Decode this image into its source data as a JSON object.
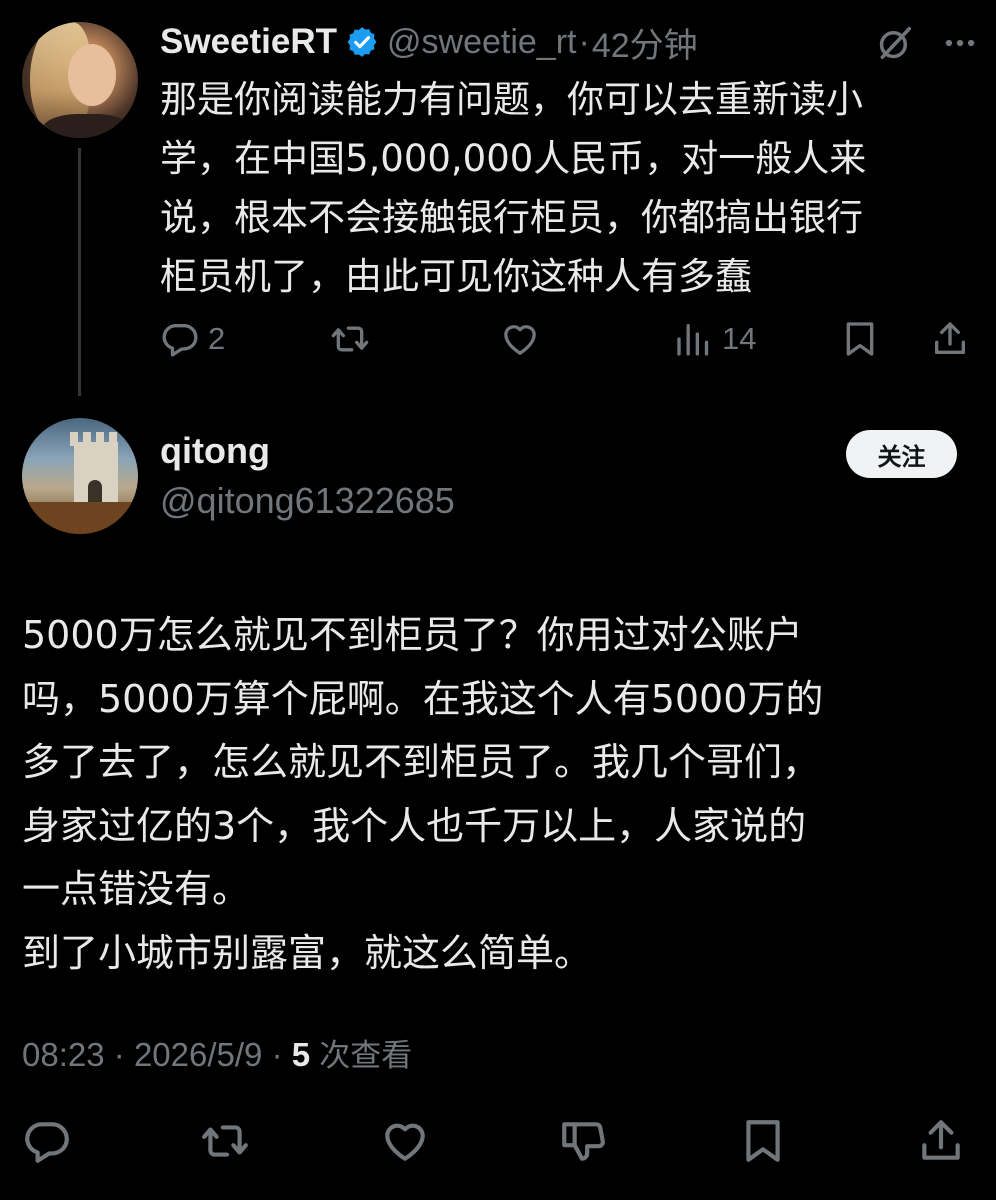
{
  "parent_tweet": {
    "display_name": "SweetieRT",
    "handle": "@sweetie_rt",
    "separator": "·",
    "time": "42分钟",
    "text": "那是你阅读能力有问题，你可以去重新读小\n学，在中国5,000,000人民币，对一般人来\n说，根本不会接触银行柜员，你都搞出银行\n柜员机了，由此可见你这种人有多蠢",
    "reply_count": "2",
    "view_count": "14",
    "icons": {
      "verified": "verified-badge-icon",
      "grok": "grok-icon",
      "more": "more-icon",
      "reply": "reply-icon",
      "retweet": "retweet-icon",
      "like": "like-icon",
      "views": "views-icon",
      "bookmark": "bookmark-icon",
      "share": "share-icon"
    }
  },
  "main_tweet": {
    "display_name": "qitong",
    "handle": "@qitong61322685",
    "follow_label": "关注",
    "text": "5000万怎么就见不到柜员了？你用过对公账户\n吗，5000万算个屁啊。在我这个人有5000万的\n多了去了，怎么就见不到柜员了。我几个哥们，\n身家过亿的3个，我个人也千万以上，人家说的\n一点错没有。\n到了小城市别露富，就这么简单。",
    "time": "08:23",
    "date": "2026/5/9",
    "separator": "·",
    "views_count": "5",
    "views_label": "次查看"
  },
  "colors": {
    "background": "#000000",
    "text_primary": "#e7e9ea",
    "text_secondary": "#71767b",
    "verified_blue": "#1d9bf0",
    "follow_button_bg": "#eff3f4",
    "follow_button_text": "#0f1419",
    "thread_line": "#333639"
  }
}
